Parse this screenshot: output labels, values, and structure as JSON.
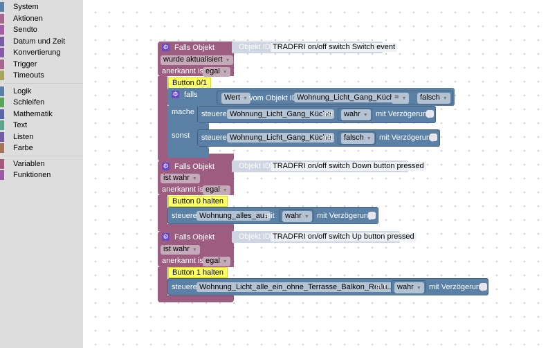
{
  "toolbox": {
    "groups": [
      [
        {
          "label": "System",
          "color": "#5b80a5"
        },
        {
          "label": "Aktionen",
          "color": "#a5678a"
        },
        {
          "label": "Sendto",
          "color": "#a55ba5"
        },
        {
          "label": "Datum und Zeit",
          "color": "#7a5ba5"
        },
        {
          "label": "Konvertierung",
          "color": "#8a5ba5"
        },
        {
          "label": "Trigger",
          "color": "#a5678a"
        },
        {
          "label": "Timeouts",
          "color": "#a5a55b"
        }
      ],
      [
        {
          "label": "Logik",
          "color": "#5b80a5"
        },
        {
          "label": "Schleifen",
          "color": "#5ba55b"
        },
        {
          "label": "Mathematik",
          "color": "#5b67a5"
        },
        {
          "label": "Text",
          "color": "#5ba58c"
        },
        {
          "label": "Listen",
          "color": "#745ba5"
        },
        {
          "label": "Farbe",
          "color": "#a5745b"
        }
      ],
      [
        {
          "label": "Variablen",
          "color": "#a55b80"
        },
        {
          "label": "Funktionen",
          "color": "#995ba5"
        }
      ]
    ]
  },
  "blocks": [
    {
      "title": "Falls Objekt",
      "id_label": "Objekt ID",
      "object_id": "TRADFRI on/off switch Switch event",
      "condition": "wurde aktualisiert",
      "ack_label": "anerkannt ist",
      "ack": "egal",
      "comment": "Button 0/1",
      "if": {
        "falls": "falls",
        "mache": "mache",
        "sonst": "sonst",
        "value_dropdown": "Wert",
        "from_label": "vom Objekt ID",
        "object": "Wohnung_Licht_Gang_Küche",
        "operator": "=",
        "compare": "falsch",
        "then": {
          "label": "steuere",
          "target": "Wohnung_Licht_Gang_Küche",
          "with": "mit",
          "value": "wahr",
          "delay": "mit Verzögerung"
        },
        "else": {
          "label": "steuere",
          "target": "Wohnung_Licht_Gang_Küche",
          "with": "mit",
          "value": "falsch",
          "delay": "mit Verzögerung"
        }
      }
    },
    {
      "title": "Falls Objekt",
      "id_label": "Objekt ID",
      "object_id": "TRADFRI on/off switch Down button pressed",
      "condition": "ist wahr",
      "ack_label": "anerkannt ist",
      "ack": "egal",
      "comment": "Button 0 halten",
      "action": {
        "label": "steuere",
        "target": "Wohnung_alles_aus",
        "with": "mit",
        "value": "wahr",
        "delay": "mit Verzögerung"
      }
    },
    {
      "title": "Falls Objekt",
      "id_label": "Objekt ID",
      "object_id": "TRADFRI on/off switch Up button pressed",
      "condition": "ist wahr",
      "ack_label": "anerkannt ist",
      "ack": "egal",
      "comment": "Button 1 halten",
      "action": {
        "label": "steuere",
        "target": "Wohnung_Licht_alle_ein_ohne_Terrasse_Balkon_Redu...",
        "with": "mit",
        "value": "wahr",
        "delay": "mit Verzögerung"
      }
    }
  ]
}
